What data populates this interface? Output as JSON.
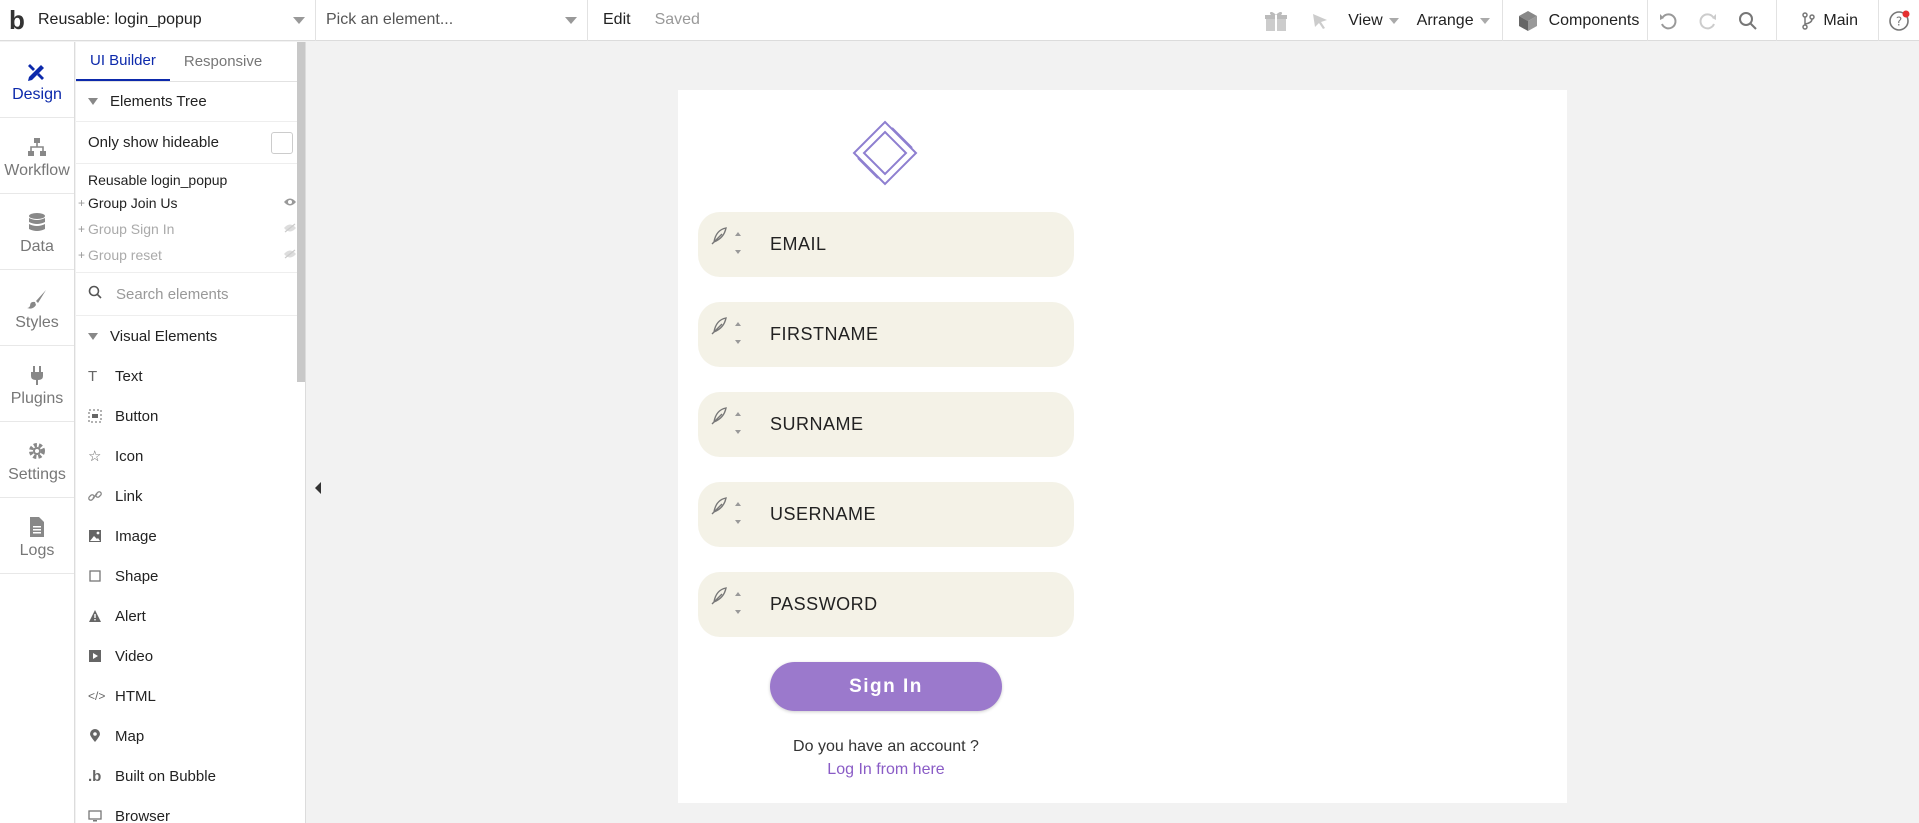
{
  "topbar": {
    "logo": "b",
    "page_name": "Reusable: login_popup",
    "element_placeholder": "Pick an element...",
    "edit_label": "Edit",
    "saved_label": "Saved",
    "view_label": "View",
    "arrange_label": "Arrange",
    "components_label": "Components",
    "branch_label": "Main"
  },
  "leftnav": {
    "items": [
      {
        "label": "Design",
        "icon": "design-icon"
      },
      {
        "label": "Workflow",
        "icon": "workflow-icon"
      },
      {
        "label": "Data",
        "icon": "database-icon"
      },
      {
        "label": "Styles",
        "icon": "brush-icon"
      },
      {
        "label": "Plugins",
        "icon": "plug-icon"
      },
      {
        "label": "Settings",
        "icon": "gear-icon"
      },
      {
        "label": "Logs",
        "icon": "document-icon"
      }
    ]
  },
  "sidepanel": {
    "tabs": [
      "UI Builder",
      "Responsive"
    ],
    "elements_tree_label": "Elements Tree",
    "only_show_label": "Only show hideable",
    "tree_root": "Reusable login_popup",
    "tree_items": [
      "Group Join Us",
      "Group Sign In",
      "Group reset"
    ],
    "search_placeholder": "Search elements",
    "visual_elements_label": "Visual Elements",
    "elements": [
      "Text",
      "Button",
      "Icon",
      "Link",
      "Image",
      "Shape",
      "Alert",
      "Video",
      "HTML",
      "Map",
      "Built on Bubble",
      "Browser"
    ]
  },
  "canvas": {
    "fields": [
      "EMAIL",
      "FIRSTNAME",
      "SURNAME",
      "USERNAME",
      "PASSWORD"
    ],
    "signin_label": "Sign In",
    "account_question": "Do you have an account ?",
    "login_link": "Log In from here"
  },
  "colors": {
    "accent": "#0c29ab",
    "button": "#9b79cc",
    "field_bg": "#f4f2e7",
    "link": "#8a5cc6"
  }
}
